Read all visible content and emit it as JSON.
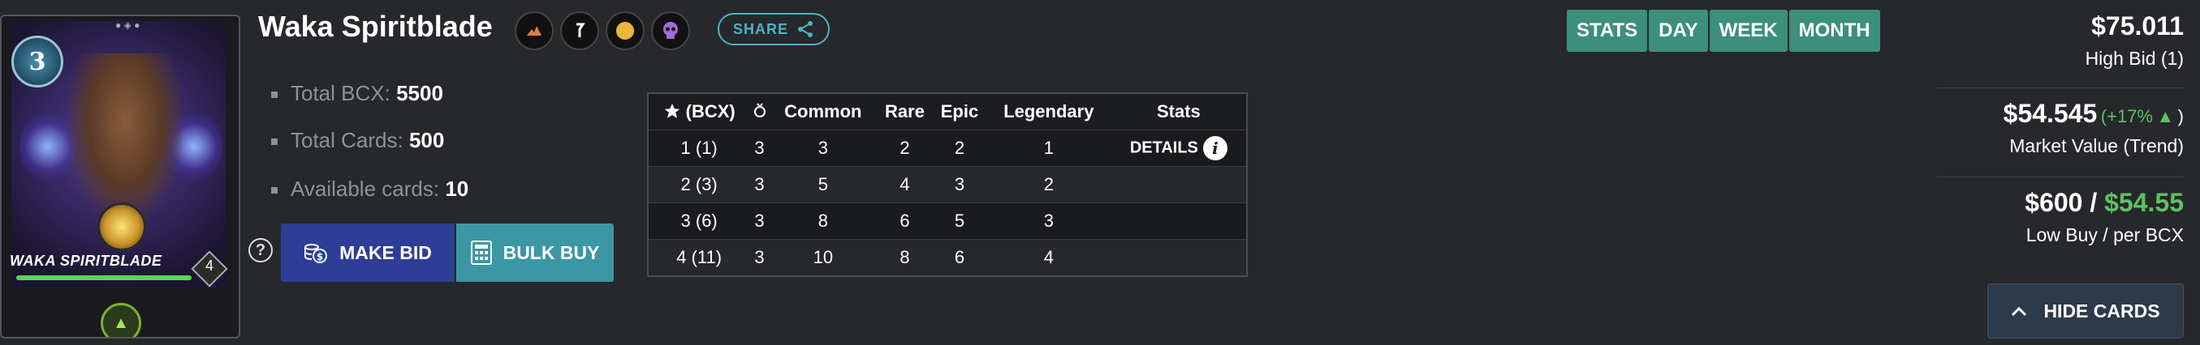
{
  "card": {
    "name": "WAKA SPIRITBLADE",
    "mana": "3",
    "level": "4",
    "element_icon": "earth-element-icon",
    "rune_icon": "gold-rune-icon"
  },
  "header": {
    "title": "Waka Spiritblade",
    "attribute_icons": [
      "fire-element-icon",
      "arrow-ability-icon",
      "gold-foil-icon",
      "purple-skull-icon"
    ],
    "share_label": "SHARE"
  },
  "stats": {
    "total_bcx_label": "Total BCX:",
    "total_bcx_value": "5500",
    "total_cards_label": "Total Cards:",
    "total_cards_value": "500",
    "available_label": "Available cards:",
    "available_value": "10"
  },
  "actions": {
    "make_bid": "MAKE BID",
    "bulk_buy": "BULK BUY"
  },
  "table": {
    "headers": [
      "(BCX)",
      "",
      "Common",
      "Rare",
      "Epic",
      "Legendary",
      "Stats"
    ],
    "rows": [
      [
        "1 (1)",
        "3",
        "3",
        "2",
        "2",
        "1",
        "DETAILS"
      ],
      [
        "2 (3)",
        "3",
        "5",
        "4",
        "3",
        "2",
        ""
      ],
      [
        "3 (6)",
        "3",
        "8",
        "6",
        "5",
        "3",
        ""
      ],
      [
        "4 (11)",
        "3",
        "10",
        "8",
        "6",
        "4",
        ""
      ]
    ]
  },
  "period_tabs": [
    "STATS",
    "DAY",
    "WEEK",
    "MONTH"
  ],
  "prices": {
    "high_bid_value": "$75.011",
    "high_bid_label": "High Bid (1)",
    "market_value": "$54.545",
    "market_trend": "(+17%",
    "market_trend_close": ")",
    "market_label": "Market Value (Trend)",
    "low_buy": "$600",
    "separator": " / ",
    "per_bcx": "$54.55",
    "low_buy_label": "Low Buy / per BCX"
  },
  "hide_cards_label": "HIDE CARDS",
  "colors": {
    "background": "#26282b",
    "make_bid": "#2e3d96",
    "bulk_buy": "#3a97a3",
    "period_tab": "#3c8f7b",
    "accent_green": "#5dc161",
    "share": "#4fb3c6"
  }
}
